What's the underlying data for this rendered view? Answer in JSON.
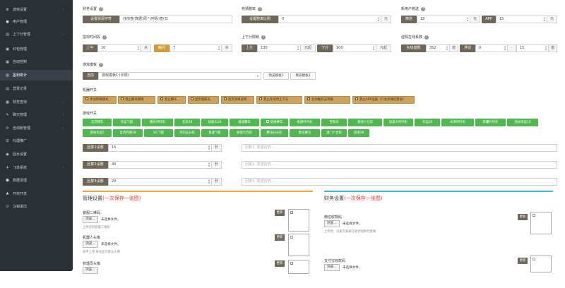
{
  "sidebar": {
    "items": [
      {
        "label": "游戏设置",
        "icon": "gear-icon",
        "glyph": "⚙",
        "arrow": "‹"
      },
      {
        "label": "用户管理",
        "icon": "user-icon",
        "glyph": "●",
        "arrow": ""
      },
      {
        "label": "上下分管理",
        "icon": "transfer-icon",
        "glyph": "▤",
        "arrow": "‹"
      },
      {
        "label": "红包管理",
        "icon": "wallet-icon",
        "glyph": "▣",
        "arrow": ""
      },
      {
        "label": "自动控制",
        "icon": "control-icon",
        "glyph": "▦",
        "arrow": ""
      },
      {
        "label": "盈利统计",
        "icon": "stats-icon",
        "glyph": "▥",
        "arrow": ""
      },
      {
        "label": "登录记录",
        "icon": "record-icon",
        "glyph": "▤",
        "arrow": ""
      },
      {
        "label": "财务查询",
        "icon": "finance-icon",
        "glyph": "▦",
        "arrow": "‹"
      },
      {
        "label": "聊天管理",
        "icon": "chat-icon",
        "glyph": "✎",
        "arrow": "‹"
      },
      {
        "label": "自动跑管理",
        "icon": "robot-icon",
        "glyph": "⟳",
        "arrow": "‹"
      },
      {
        "label": "代理推广",
        "icon": "share-icon",
        "glyph": "☰",
        "arrow": ""
      },
      {
        "label": "回水设置",
        "icon": "refund-icon",
        "glyph": "◉",
        "arrow": ""
      },
      {
        "label": "飞单系统",
        "icon": "plane-icon",
        "glyph": "✈",
        "arrow": "‹"
      },
      {
        "label": "数据清理",
        "icon": "clean-icon",
        "glyph": "☻",
        "arrow": ""
      },
      {
        "label": "开奖开发",
        "icon": "lottery-icon",
        "glyph": "♣",
        "arrow": ""
      },
      {
        "label": "注销退出",
        "icon": "power-icon",
        "glyph": "⏻",
        "arrow": ""
      }
    ]
  },
  "main": {
    "s1": {
      "title": "财务设置",
      "btn": "设置票源字符",
      "value": "往前查(数据)周^(时段)查(日"
    },
    "s2": {
      "title": "竞猜赔率",
      "btn": "设置赔率比例",
      "value": "0",
      "unit": "元"
    },
    "s3": {
      "title": "新用户赠送",
      "btn1": "微信",
      "value1": "18",
      "unit1": "元",
      "btn2": "APP",
      "value2": "15",
      "unit2": "元"
    },
    "row2": {
      "a_title": "提现时间段",
      "a_btn1": "上午",
      "a_val1": "10",
      "a_unit1": "点",
      "a_btn2": "晚间",
      "a_val2": "7",
      "a_unit2": "点",
      "b_title": "上下分限制",
      "b_btn1": "上分",
      "b_val1": "100",
      "b_unit1": "元起",
      "b_btn2": "下分",
      "b_val2": "100",
      "b_unit2": "元起",
      "c_title": "虚假在线系数",
      "c_btn1": "在线基数",
      "c_val1": "352",
      "c_unit1": "值",
      "c_btn2": "浮动",
      "c_val2": "0",
      "c_unit2": "-",
      "c_val3": "15",
      "c_unit3": "值"
    },
    "template": {
      "title": "游戏模板",
      "btn": "当前",
      "select": "游戏模板1 (长屏)",
      "p1": "预览模板1",
      "p2": "预览模板2"
    },
    "switch": {
      "title": "机器开关",
      "items": [
        {
          "label": "手动审核模式",
          "on": true
        },
        {
          "label": "禁止最早期限",
          "on": false
        },
        {
          "label": "禁止聊天",
          "on": true
        },
        {
          "label": "显示假聊天",
          "on": true
        },
        {
          "label": "显示游戏说明",
          "on": true
        },
        {
          "label": "禁止在线时上下分",
          "on": false
        },
        {
          "label": "允许推荐员等级",
          "on": true
        },
        {
          "label": "禁止APP注册（只允许微信登录）",
          "on": false
        }
      ]
    },
    "games": {
      "title": "游戏开关",
      "row1": [
        {
          "label": "北京赛车",
          "on": false
        },
        {
          "label": "幸运飞艇",
          "on": false
        },
        {
          "label": "重庆时时彩",
          "on": false
        },
        {
          "label": "北京28",
          "on": false
        },
        {
          "label": "加拿大28",
          "on": false
        },
        {
          "label": "极速赛车",
          "on": false
        },
        {
          "label": "极速赛车",
          "on": true
        },
        {
          "label": "极速时时彩",
          "on": false
        },
        {
          "label": "百家乐",
          "on": false
        },
        {
          "label": "香港六合彩",
          "on": false
        },
        {
          "label": "加拿大时时彩",
          "on": false
        },
        {
          "label": "幸运28",
          "on": false
        },
        {
          "label": "天津时时彩",
          "on": false
        },
        {
          "label": "新疆时时彩",
          "on": false
        },
        {
          "label": "澳洲幸运10",
          "on": false
        }
      ],
      "row2": [
        {
          "label": "澳洲幸运5",
          "on": false
        },
        {
          "label": "台湾宾果28",
          "on": false
        },
        {
          "label": "SG飞艇",
          "on": false
        },
        {
          "label": "河内五分彩",
          "on": false
        },
        {
          "label": "极速飞艇",
          "on": false
        },
        {
          "label": "极速六合彩",
          "on": false
        },
        {
          "label": "腾讯分分彩",
          "on": false
        },
        {
          "label": "欧乐赛马",
          "on": false
        },
        {
          "label": "澳门六合彩",
          "on": false
        },
        {
          "label": "极速28",
          "on": false
        }
      ]
    },
    "msgs": [
      {
        "btn": "回复1设置",
        "value": "15",
        "unit": "秒",
        "placeholder": "回复1: 发送内容..."
      },
      {
        "btn": "回复2设置",
        "value": "40",
        "unit": "秒",
        "placeholder": "回复2: 发送内容..."
      },
      {
        "btn": "回复3设置",
        "value": "20",
        "unit": "秒",
        "placeholder": "回复3: 发送内容..."
      }
    ],
    "manage": {
      "title": "管理设置",
      "title_note": "(一次保存一张图)",
      "items": [
        {
          "label": "客服二维码",
          "btn": "浏览...",
          "file": "未选择文件。",
          "hint": "上传您的客服二维码",
          "save": "更新"
        },
        {
          "label": "机器人头像",
          "btn": "浏览...",
          "file": "未选择文件。",
          "hint": "如不上传 将会显示默认头像",
          "save": "更新"
        },
        {
          "label": "管理员头像",
          "btn": "浏览...",
          "file": "",
          "hint": "",
          "save": "更新"
        }
      ]
    },
    "finance": {
      "title": "财务设置",
      "title_note": "(一次保存一张图)",
      "items": [
        {
          "label": "微信收款码",
          "btn": "浏览...",
          "file": "未选择文件。",
          "hint": "上传后，玩家可直接在联合国附代复填",
          "save": "更新"
        },
        {
          "label": "支付宝收款码",
          "btn": "浏览...",
          "file": "未选择文件。",
          "hint": "",
          "save": "更新"
        }
      ]
    }
  }
}
